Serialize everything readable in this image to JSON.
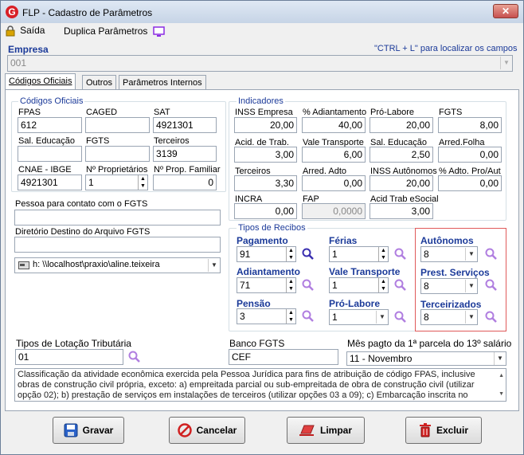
{
  "window": {
    "title": "FLP - Cadastro de Parâmetros",
    "close": "✕"
  },
  "toolbar": {
    "saida": "Saída",
    "duplica": "Duplica Parâmetros"
  },
  "empresa": {
    "label": "Empresa",
    "hint": "\"CTRL + L\" para localizar os campos",
    "value": "001"
  },
  "tabs": [
    "Códigos Oficiais",
    "Outros",
    "Parâmetros Internos"
  ],
  "codigos": {
    "title": "Códigos Oficiais",
    "fpas": {
      "label": "FPAS",
      "value": "612"
    },
    "caged": {
      "label": "CAGED",
      "value": ""
    },
    "sat": {
      "label": "SAT",
      "value": "4921301"
    },
    "sal_edu": {
      "label": "Sal. Educação",
      "value": ""
    },
    "fgts": {
      "label": "FGTS",
      "value": ""
    },
    "terceiros": {
      "label": "Terceiros",
      "value": "3139"
    },
    "cnae": {
      "label": "CNAE - IBGE",
      "value": "4921301"
    },
    "nprop": {
      "label": "Nº Proprietários",
      "value": "1"
    },
    "nfam": {
      "label": "Nº Prop. Familiar",
      "value": "0"
    }
  },
  "contato": {
    "label": "Pessoa para contato com o FGTS",
    "value": ""
  },
  "diretorio": {
    "label": "Diretório Destino do Arquivo FGTS",
    "value": "",
    "drive": "h: \\\\localhost\\praxio\\aline.teixeira"
  },
  "indicadores": {
    "title": "Indicadores",
    "inss_emp": {
      "label": "INSS Empresa",
      "value": "20,00"
    },
    "adiant": {
      "label": "% Adiantamento",
      "value": "40,00"
    },
    "pro_labore": {
      "label": "Pró-Labore",
      "value": "20,00"
    },
    "fgts": {
      "label": "FGTS",
      "value": "8,00"
    },
    "acid": {
      "label": "Acid. de Trab.",
      "value": "3,00"
    },
    "vale": {
      "label": "Vale Transporte",
      "value": "6,00"
    },
    "sal_edu": {
      "label": "Sal. Educação",
      "value": "2,50"
    },
    "arred_folha": {
      "label": "Arred.Folha",
      "value": "0,00"
    },
    "terceiros": {
      "label": "Terceiros",
      "value": "3,30"
    },
    "arred_adto": {
      "label": "Arred. Adto",
      "value": "0,00"
    },
    "inss_aut": {
      "label": "INSS Autônomos",
      "value": "20,00"
    },
    "pct_adto": {
      "label": "% Adto. Pro/Aut",
      "value": "0,00"
    },
    "incra": {
      "label": "INCRA",
      "value": "0,00"
    },
    "fap": {
      "label": "FAP",
      "value": "0,0000"
    },
    "acid_esocial": {
      "label": "Acid Trab eSocial",
      "value": "3,00"
    }
  },
  "recibos": {
    "title": "Tipos de Recibos",
    "pagamento": {
      "label": "Pagamento",
      "value": "91"
    },
    "ferias": {
      "label": "Férias",
      "value": "1"
    },
    "autonomos": {
      "label": "Autônomos",
      "value": "8"
    },
    "adiantamento": {
      "label": "Adiantamento",
      "value": "71"
    },
    "vale": {
      "label": "Vale Transporte",
      "value": "1"
    },
    "prest": {
      "label": "Prest. Serviços",
      "value": "8"
    },
    "pensao": {
      "label": "Pensão",
      "value": "3"
    },
    "pro_labore": {
      "label": "Pró-Labore",
      "value": "1"
    },
    "terceirizados": {
      "label": "Terceirizados",
      "value": "8"
    }
  },
  "lotacao": {
    "label": "Tipos de Lotação Tributária",
    "value": "01"
  },
  "banco": {
    "label": "Banco FGTS",
    "value": "CEF"
  },
  "mes13": {
    "label": "Mês pagto da 1ª parcela do 13º salário",
    "value": "11 -  Novembro"
  },
  "info": "Classificação da atividade econômica exercida pela Pessoa Jurídica para fins de atribuição de código FPAS, inclusive obras de construção civil própria, exceto: a) empreitada parcial ou sub-empreitada de obra de construção civil (utilizar opção 02); b) prestação de serviços em instalações de terceiros (utilizar opções 03 a 09); c) Embarcação inscrita no Registro Especial",
  "buttons": {
    "gravar": "Gravar",
    "cancelar": "Cancelar",
    "limpar": "Limpar",
    "excluir": "Excluir"
  }
}
